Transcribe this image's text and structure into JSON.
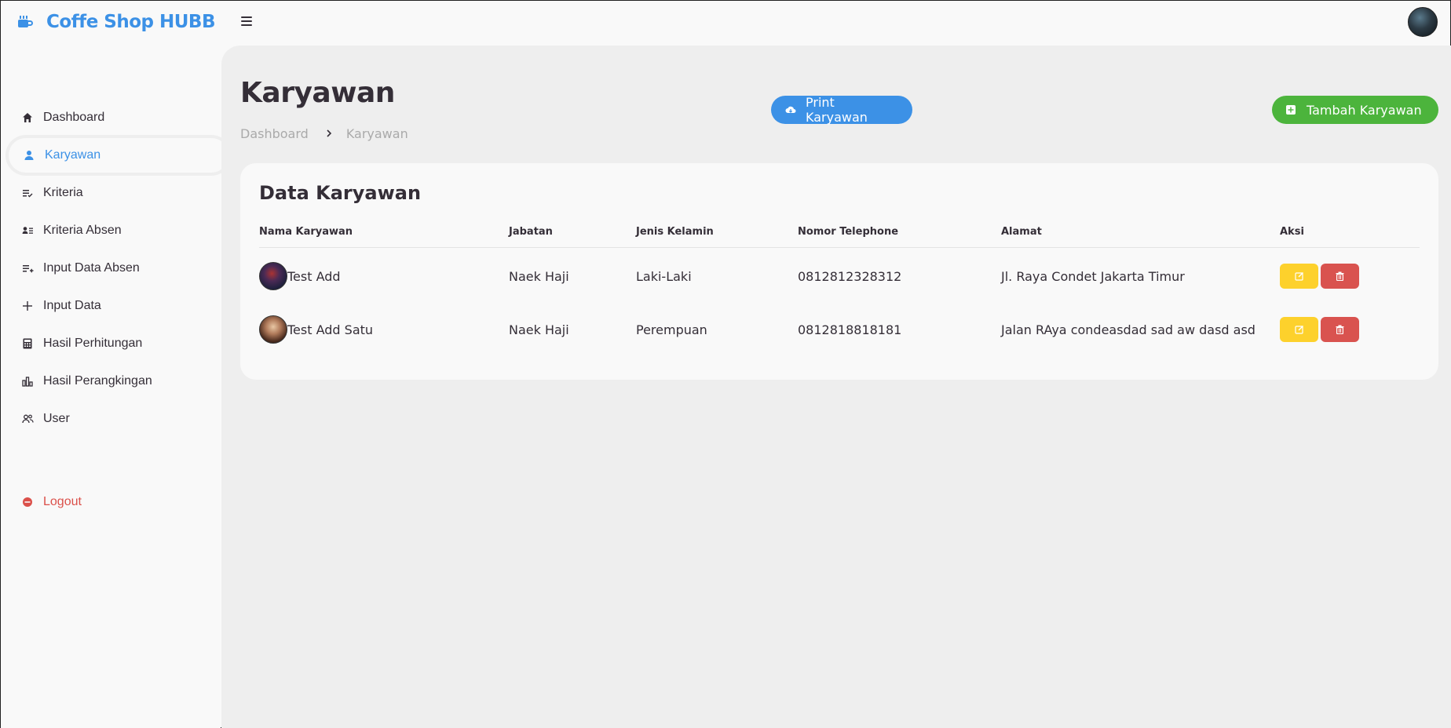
{
  "brand": {
    "name": "Coffe Shop HUBB",
    "color": "#3c91e6"
  },
  "sidebar": {
    "items": [
      {
        "label": "Dashboard",
        "icon": "home-icon"
      },
      {
        "label": "Karyawan",
        "icon": "user-icon",
        "active": true
      },
      {
        "label": "Kriteria",
        "icon": "list-check-icon"
      },
      {
        "label": "Kriteria Absen",
        "icon": "user-list-icon"
      },
      {
        "label": "Input Data Absen",
        "icon": "list-add-icon"
      },
      {
        "label": "Input Data",
        "icon": "plus-icon"
      },
      {
        "label": "Hasil Perhitungan",
        "icon": "calculator-icon"
      },
      {
        "label": "Hasil Perangkingan",
        "icon": "bar-chart-icon"
      },
      {
        "label": "User",
        "icon": "users-icon"
      }
    ],
    "logout": {
      "label": "Logout",
      "icon": "logout-icon",
      "color": "#db504a"
    }
  },
  "header": {
    "title": "Karyawan",
    "breadcrumb": [
      "Dashboard",
      "Karyawan"
    ],
    "print_label": "Print Karyawan",
    "add_label": "Tambah Karyawan"
  },
  "table": {
    "title": "Data Karyawan",
    "columns": [
      "Nama Karyawan",
      "Jabatan",
      "Jenis Kelamin",
      "Nomor Telephone",
      "Alamat",
      "Aksi"
    ],
    "rows": [
      {
        "nama": "Test Add",
        "jabatan": "Naek Haji",
        "jenis_kelamin": "Laki-Laki",
        "telepon": "0812812328312",
        "alamat": "Jl. Raya Condet Jakarta Timur"
      },
      {
        "nama": "Test Add Satu",
        "jabatan": "Naek Haji",
        "jenis_kelamin": "Perempuan",
        "telepon": "0812818818181",
        "alamat": "Jalan RAya condeasdad sad aw dasd asd"
      }
    ]
  },
  "colors": {
    "primary": "#3c91e6",
    "success": "#4cb43c",
    "warning": "#fdd12c",
    "danger": "#d9534f"
  }
}
